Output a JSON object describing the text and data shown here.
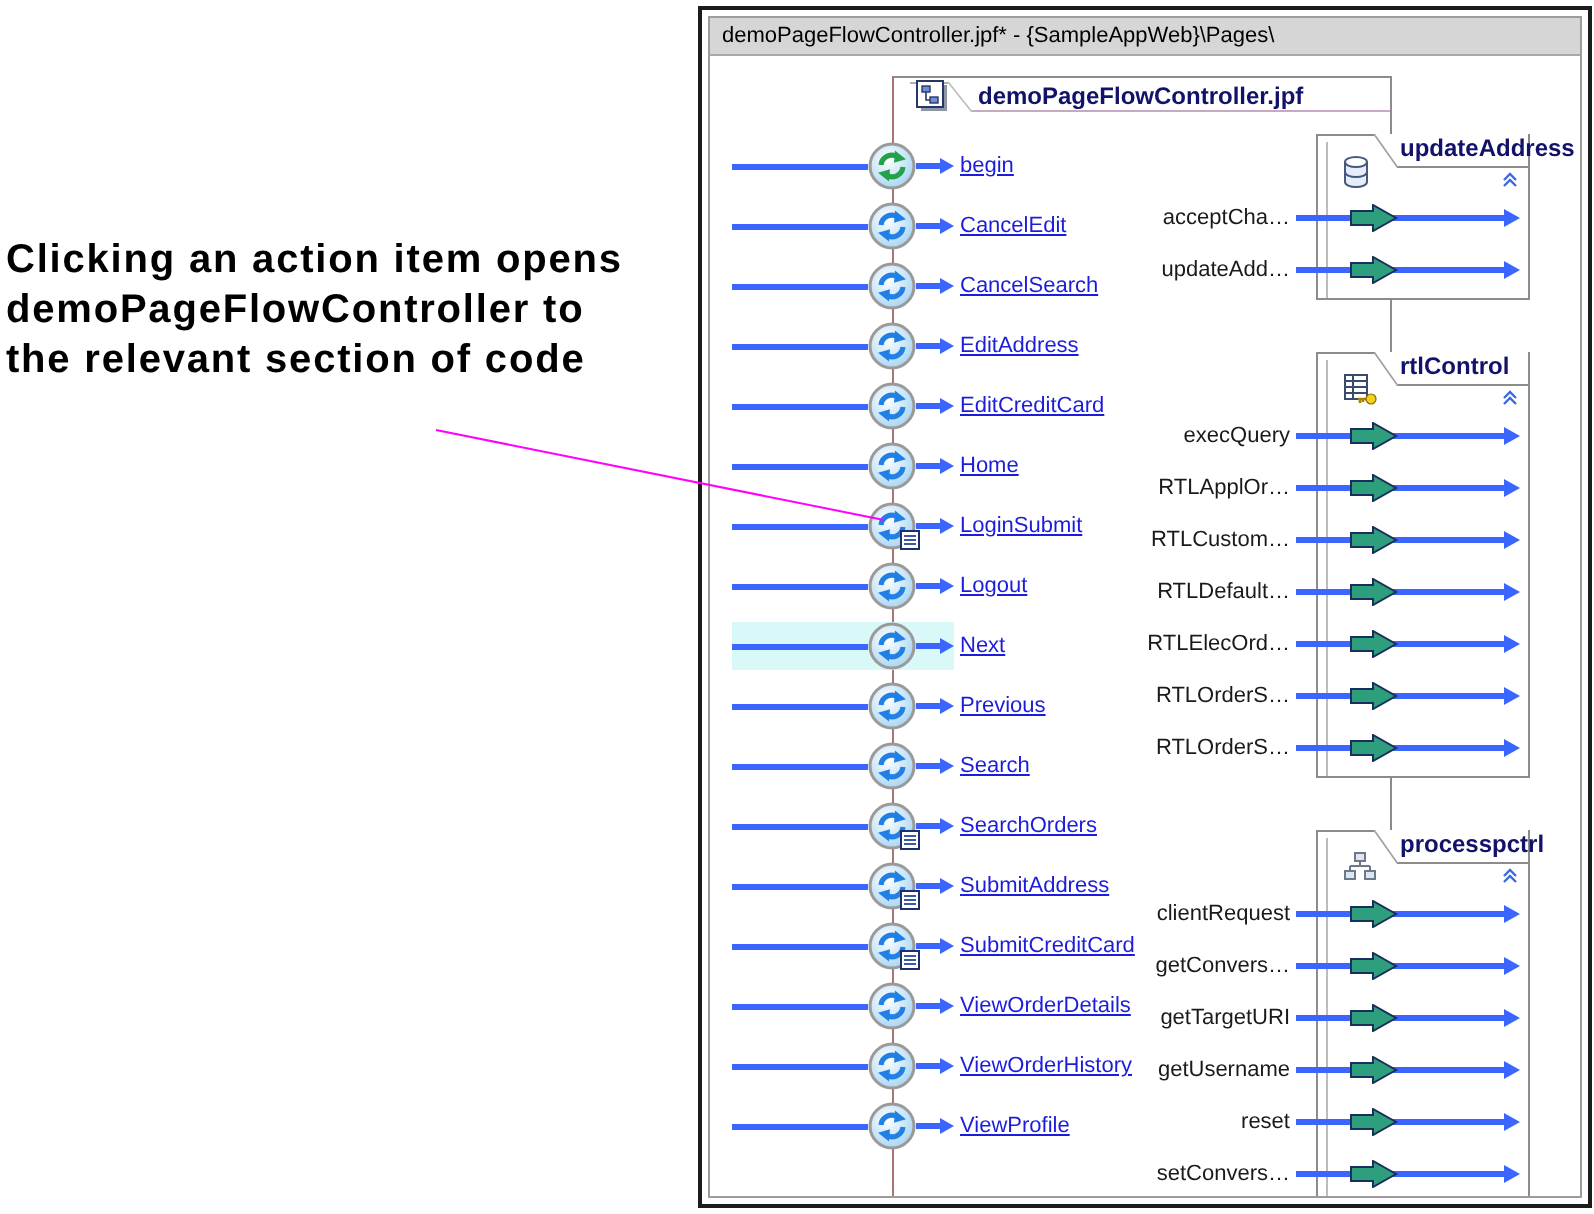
{
  "callout": {
    "text": "Clicking an action item opens demoPageFlowController to the relevant section of code"
  },
  "window": {
    "title": "demoPageFlowController.jpf* - {SampleAppWeb}\\Pages\\"
  },
  "controller": {
    "title": "demoPageFlowController.jpf",
    "actions": [
      {
        "label": "begin",
        "kind": "begin",
        "selected": false
      },
      {
        "label": "CancelEdit",
        "kind": "action",
        "selected": false
      },
      {
        "label": "CancelSearch",
        "kind": "action",
        "selected": false
      },
      {
        "label": "EditAddress",
        "kind": "action",
        "selected": false
      },
      {
        "label": "EditCreditCard",
        "kind": "action",
        "selected": false
      },
      {
        "label": "Home",
        "kind": "action",
        "selected": false
      },
      {
        "label": "LoginSubmit",
        "kind": "form",
        "selected": false
      },
      {
        "label": "Logout",
        "kind": "action",
        "selected": false
      },
      {
        "label": "Next",
        "kind": "action",
        "selected": true
      },
      {
        "label": "Previous",
        "kind": "action",
        "selected": false
      },
      {
        "label": "Search",
        "kind": "action",
        "selected": false
      },
      {
        "label": "SearchOrders",
        "kind": "form",
        "selected": false
      },
      {
        "label": "SubmitAddress",
        "kind": "form",
        "selected": false
      },
      {
        "label": "SubmitCreditCard",
        "kind": "form",
        "selected": false
      },
      {
        "label": "ViewOrderDetails",
        "kind": "action",
        "selected": false
      },
      {
        "label": "ViewOrderHistory",
        "kind": "action",
        "selected": false
      },
      {
        "label": "ViewProfile",
        "kind": "action",
        "selected": false
      }
    ]
  },
  "controls": [
    {
      "name": "updateAddress",
      "kind": "database",
      "methods": [
        "acceptCha…",
        "updateAdd…"
      ]
    },
    {
      "name": "rtlControl",
      "kind": "table",
      "methods": [
        "execQuery",
        "RTLApplOr…",
        "RTLCustom…",
        "RTLDefault…",
        "RTLElecOrd…",
        "RTLOrderS…",
        "RTLOrderS…"
      ]
    },
    {
      "name": "processpctrl",
      "kind": "hierarchy",
      "methods": [
        "clientRequest",
        "getConvers…",
        "getTargetURI",
        "getUsername",
        "reset",
        "setConvers…"
      ]
    }
  ]
}
